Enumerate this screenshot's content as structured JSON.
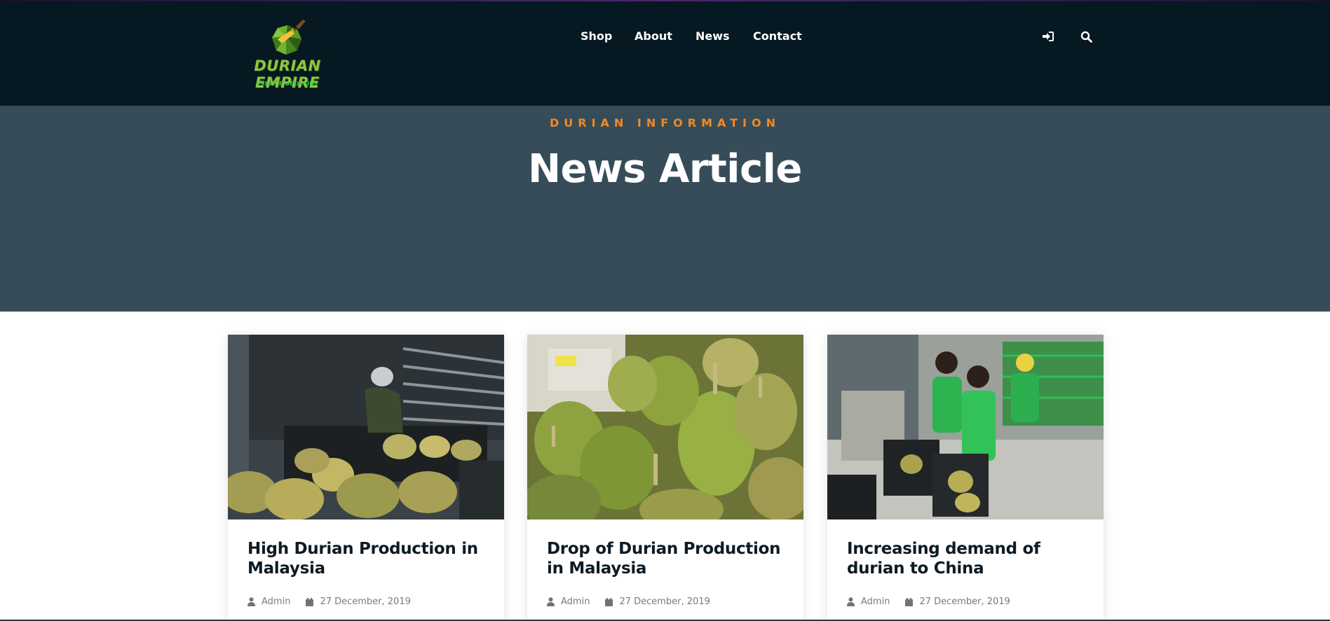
{
  "brand": {
    "name": "DURIAN EMPIRE",
    "tagline": "FRESH & DELICIOUS",
    "logo_icon": "durian-logo-icon",
    "colors": {
      "name": "#8ec63f",
      "tagline": "#39d443"
    }
  },
  "nav": {
    "items": [
      {
        "label": "Shop"
      },
      {
        "label": "About"
      },
      {
        "label": "News"
      },
      {
        "label": "Contact"
      }
    ],
    "icons": [
      "login-icon",
      "search-icon"
    ]
  },
  "hero": {
    "eyebrow": "DURIAN INFORMATION",
    "title": "News Article",
    "colors": {
      "background": "#364c59",
      "eyebrow": "#f08a24"
    }
  },
  "articles": [
    {
      "title": "High Durian Production in Malaysia",
      "author": "Admin",
      "date": "27 December, 2019",
      "image_icon": "durian-truck-photo"
    },
    {
      "title": "Drop of Durian Production in Malaysia",
      "author": "Admin",
      "date": "27 December, 2019",
      "image_icon": "durian-pile-photo"
    },
    {
      "title": "Increasing demand of durian to China",
      "author": "Admin",
      "date": "27 December, 2019",
      "image_icon": "durian-workers-photo"
    }
  ],
  "colors": {
    "header_bg": "#061821",
    "page_bg": "#ffffff"
  }
}
